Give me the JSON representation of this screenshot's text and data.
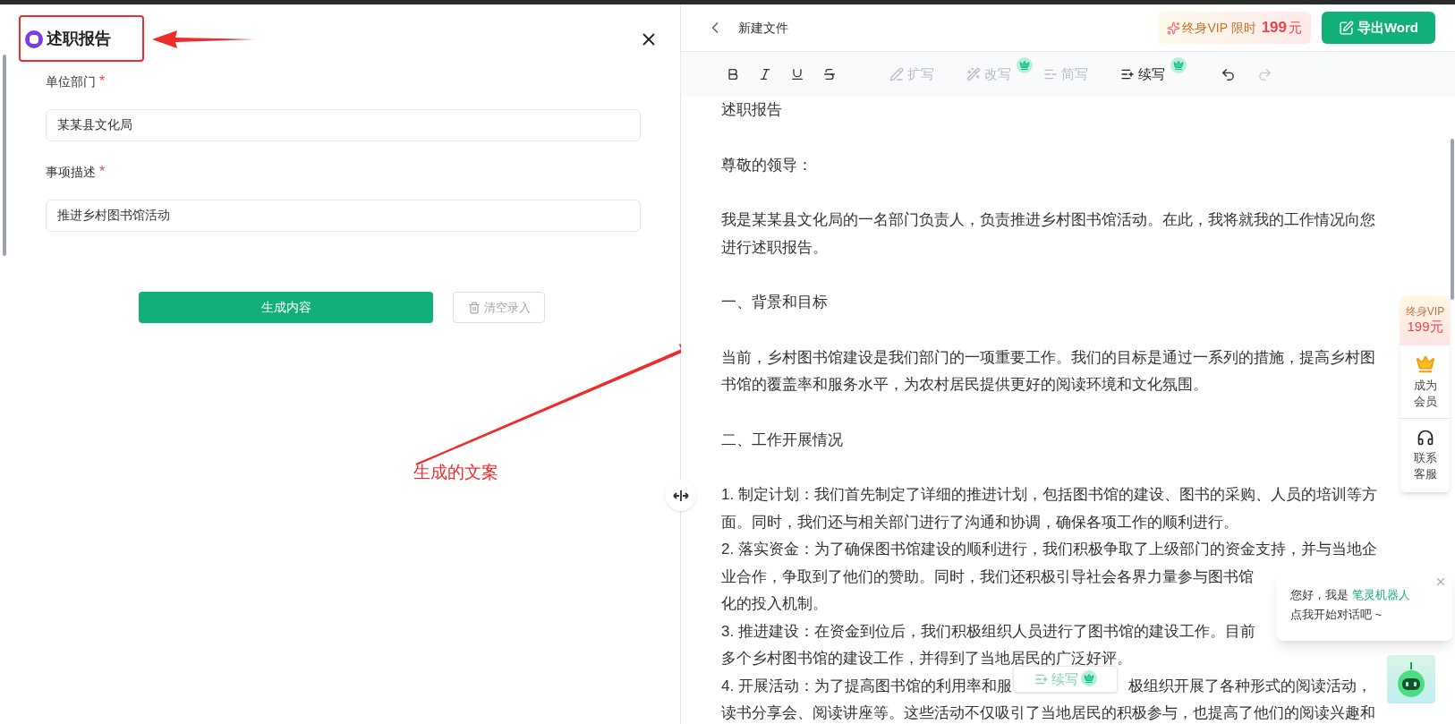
{
  "form": {
    "title": "述职报告",
    "fields": [
      {
        "label": "单位部门",
        "required": true,
        "required_mark": "*",
        "value": "某某县文化局"
      },
      {
        "label": "事项描述",
        "required": true,
        "required_mark": "*",
        "value": "推进乡村图书馆活动"
      }
    ],
    "generate_button": "生成内容",
    "clear_button": "清空录入"
  },
  "annotation": {
    "label": "生成的文案"
  },
  "editor": {
    "title": "新建文件",
    "vip_offer": {
      "label": "终身VIP 限时",
      "price": "199",
      "unit": "元"
    },
    "export_button": "导出Word",
    "ai_tools": [
      {
        "kind": "expand",
        "label": "扩写",
        "disabled": true,
        "premium": false
      },
      {
        "kind": "rewrite",
        "label": "改写",
        "disabled": true,
        "premium": true
      },
      {
        "kind": "shorten",
        "label": "简写",
        "disabled": true,
        "premium": false
      },
      {
        "kind": "continue",
        "label": "续写",
        "disabled": false,
        "premium": true
      }
    ],
    "history": [
      {
        "kind": "undo",
        "disabled": false
      },
      {
        "kind": "redo",
        "disabled": true
      }
    ],
    "blocks": [
      {
        "lines": [
          [
            "述职报告"
          ]
        ]
      },
      {
        "lines": [
          [
            "尊敬的领导："
          ]
        ]
      },
      {
        "lines": [
          [
            "我是某某县文化局的一名部门负责人，负责推进乡村图书馆活动。在此，我将就我的工作情况向您"
          ],
          [
            "进行述职报告。"
          ]
        ]
      },
      {
        "lines": [
          [
            "一、背景和目标"
          ]
        ]
      },
      {
        "lines": [
          [
            "当前，乡村图书馆建设是我们部门的一项重要工作。我们的目标是通过一系列的措施，提高乡村图"
          ],
          [
            "书馆的覆盖率和服务水平，为农村居民提供更好的阅读环境和文化氛围。"
          ]
        ]
      },
      {
        "lines": [
          [
            "二、工作开展情况"
          ]
        ]
      },
      {
        "lines": [
          [
            "1. 制定计划：我们首先制定了详细的推进计划，包括图书馆的建设、图书的采购、人员的培训等方"
          ],
          [
            "面。同时，我们还与相关部门进行了沟通和协调，确保各项工作的顺利进行。"
          ],
          [
            "2. 落实资金：为了确保图书馆建设的顺利进行，我们积极争取了上级部门的资金支持，并与当地企"
          ],
          [
            "业合作，争取到了他们的赞助。同时，我们还积极引导社会各界力量参与图书馆"
          ],
          [
            "化的投入机制。"
          ],
          [
            "3. 推进建设：在资金到位后，我们积极组织人员进行了图书馆的建设工作。目前"
          ],
          [
            "多个乡村图书馆的建设工作，并得到了当地居民的广泛好评。"
          ],
          [
            "4. 开展活动：为了提高图书馆的利用率和服",
            "极组织开展了各种形式的阅读活动，"
          ],
          [
            "读书分享会、阅读讲座等。这些活动不仅吸引了当地居民的积极参与，也提高了他们的阅读兴趣和"
          ]
        ]
      }
    ],
    "floating_button": {
      "label": "续写",
      "premium": true
    }
  },
  "side_widgets": [
    {
      "kind": "vip",
      "lines": [
        "终身VIP",
        "199元"
      ]
    },
    {
      "kind": "member",
      "label": "成为会员"
    },
    {
      "kind": "service",
      "label": "联系客服"
    }
  ],
  "chat_popup": {
    "greeting": "您好，我是",
    "bot_name": "笔灵机器人",
    "prompt": "点我开始对话吧 ~"
  }
}
